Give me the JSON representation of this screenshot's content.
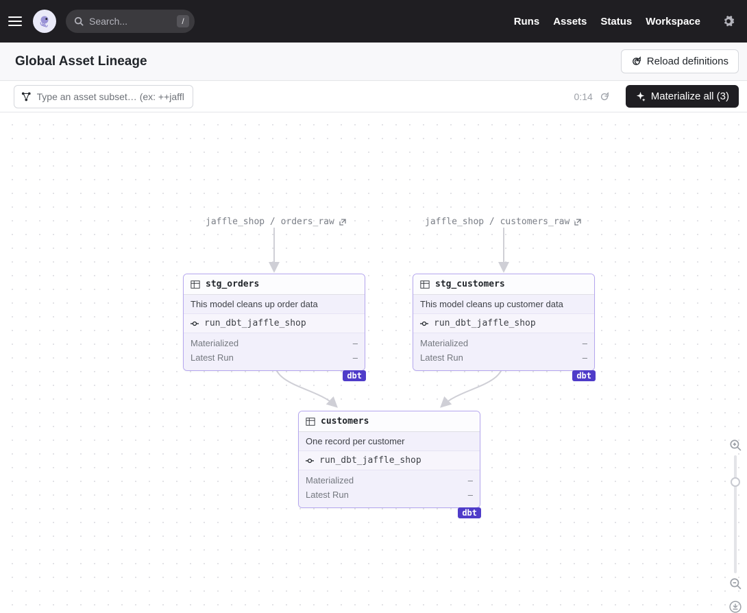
{
  "nav": {
    "search_placeholder": "Search...",
    "kbd": "/",
    "links": [
      "Runs",
      "Assets",
      "Status",
      "Workspace"
    ]
  },
  "subheader": {
    "title": "Global Asset Lineage",
    "reload_label": "Reload definitions"
  },
  "toolbar": {
    "subset_placeholder": "Type an asset subset… (ex: ++jaffl",
    "timestamp": "0:14",
    "materialize_label": "Materialize all (3)"
  },
  "sources": {
    "orders": "jaffle_shop / orders_raw",
    "customers": "jaffle_shop / customers_raw"
  },
  "cards": {
    "stg_orders": {
      "name": "stg_orders",
      "desc": "This model cleans up order data",
      "job": "run_dbt_jaffle_shop",
      "materialized_label": "Materialized",
      "materialized_value": "–",
      "latest_label": "Latest Run",
      "latest_value": "–",
      "badge": "dbt"
    },
    "stg_customers": {
      "name": "stg_customers",
      "desc": "This model cleans up customer data",
      "job": "run_dbt_jaffle_shop",
      "materialized_label": "Materialized",
      "materialized_value": "–",
      "latest_label": "Latest Run",
      "latest_value": "–",
      "badge": "dbt"
    },
    "customers": {
      "name": "customers",
      "desc": "One record per customer",
      "job": "run_dbt_jaffle_shop",
      "materialized_label": "Materialized",
      "materialized_value": "–",
      "latest_label": "Latest Run",
      "latest_value": "–",
      "badge": "dbt"
    }
  }
}
